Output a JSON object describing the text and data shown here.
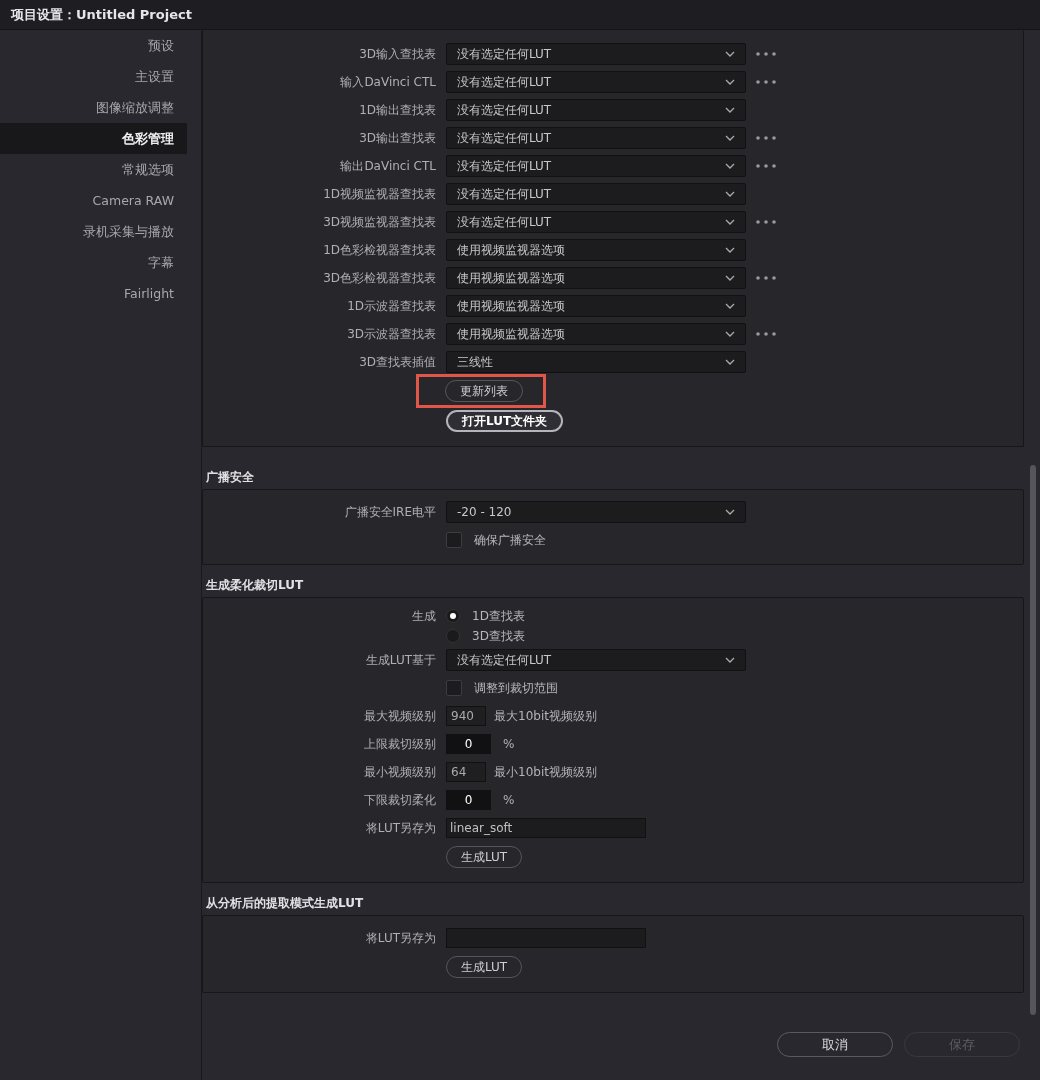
{
  "window": {
    "title": "项目设置：Untitled Project"
  },
  "sidebar": {
    "items": [
      {
        "label": "预设",
        "selected": false
      },
      {
        "label": "主设置",
        "selected": false
      },
      {
        "label": "图像缩放调整",
        "selected": false
      },
      {
        "label": "色彩管理",
        "selected": true
      },
      {
        "label": "常规选项",
        "selected": false
      },
      {
        "label": "Camera RAW",
        "selected": false
      },
      {
        "label": "录机采集与播放",
        "selected": false
      },
      {
        "label": "字幕",
        "selected": false
      },
      {
        "label": "Fairlight",
        "selected": false
      }
    ]
  },
  "lut_panel": {
    "rows": [
      {
        "label": "3D输入查找表",
        "value": "没有选定任何LUT",
        "has_more": true
      },
      {
        "label": "输入DaVinci CTL",
        "value": "没有选定任何LUT",
        "has_more": true
      },
      {
        "label": "1D输出查找表",
        "value": "没有选定任何LUT",
        "has_more": false
      },
      {
        "label": "3D输出查找表",
        "value": "没有选定任何LUT",
        "has_more": true
      },
      {
        "label": "输出DaVinci CTL",
        "value": "没有选定任何LUT",
        "has_more": true
      },
      {
        "label": "1D视频监视器查找表",
        "value": "没有选定任何LUT",
        "has_more": false
      },
      {
        "label": "3D视频监视器查找表",
        "value": "没有选定任何LUT",
        "has_more": true
      },
      {
        "label": "1D色彩检视器查找表",
        "value": "使用视频监视器选项",
        "has_more": false
      },
      {
        "label": "3D色彩检视器查找表",
        "value": "使用视频监视器选项",
        "has_more": true
      },
      {
        "label": "1D示波器查找表",
        "value": "使用视频监视器选项",
        "has_more": false
      },
      {
        "label": "3D示波器查找表",
        "value": "使用视频监视器选项",
        "has_more": true
      },
      {
        "label": "3D查找表插值",
        "value": "三线性",
        "has_more": false
      }
    ],
    "buttons": [
      {
        "label": "更新列表",
        "highlighted": true,
        "emphasized": false
      },
      {
        "label": "打开LUT文件夹",
        "highlighted": false,
        "emphasized": true
      }
    ]
  },
  "sections": [
    {
      "title": "广播安全",
      "rows": [
        {
          "kind": "dropdown",
          "label": "广播安全IRE电平",
          "value": "-20 - 120"
        },
        {
          "kind": "checkbox",
          "text": "确保广播安全",
          "checked": false
        }
      ]
    },
    {
      "title": "生成柔化裁切LUT",
      "rows": [
        {
          "kind": "radio",
          "label": "生成",
          "options": [
            {
              "text": "1D查找表",
              "selected": true
            },
            {
              "text": "3D查找表",
              "selected": false
            }
          ]
        },
        {
          "kind": "dropdown",
          "label": "生成LUT基于",
          "value": "没有选定任何LUT"
        },
        {
          "kind": "checkbox",
          "text": "调整到裁切范围",
          "checked": false
        },
        {
          "kind": "number",
          "label": "最大视频级别",
          "value": "940",
          "unit": "最大10bit视频级别"
        },
        {
          "kind": "spin",
          "label": "上限裁切级别",
          "value": "0",
          "unit": "%"
        },
        {
          "kind": "number",
          "label": "最小视频级别",
          "value": "64",
          "unit": "最小10bit视频级别"
        },
        {
          "kind": "spin",
          "label": "下限裁切柔化",
          "value": "0",
          "unit": "%"
        },
        {
          "kind": "text",
          "label": "将LUT另存为",
          "value": "linear_soft"
        },
        {
          "kind": "button",
          "text": "生成LUT"
        }
      ]
    },
    {
      "title": "从分析后的提取模式生成LUT",
      "rows": [
        {
          "kind": "text",
          "label": "将LUT另存为"
        },
        {
          "kind": "button",
          "text": "生成LUT"
        }
      ]
    }
  ],
  "footer": {
    "buttons": [
      {
        "label": "取消",
        "disabled": false
      },
      {
        "label": "保存",
        "disabled": true
      }
    ]
  }
}
